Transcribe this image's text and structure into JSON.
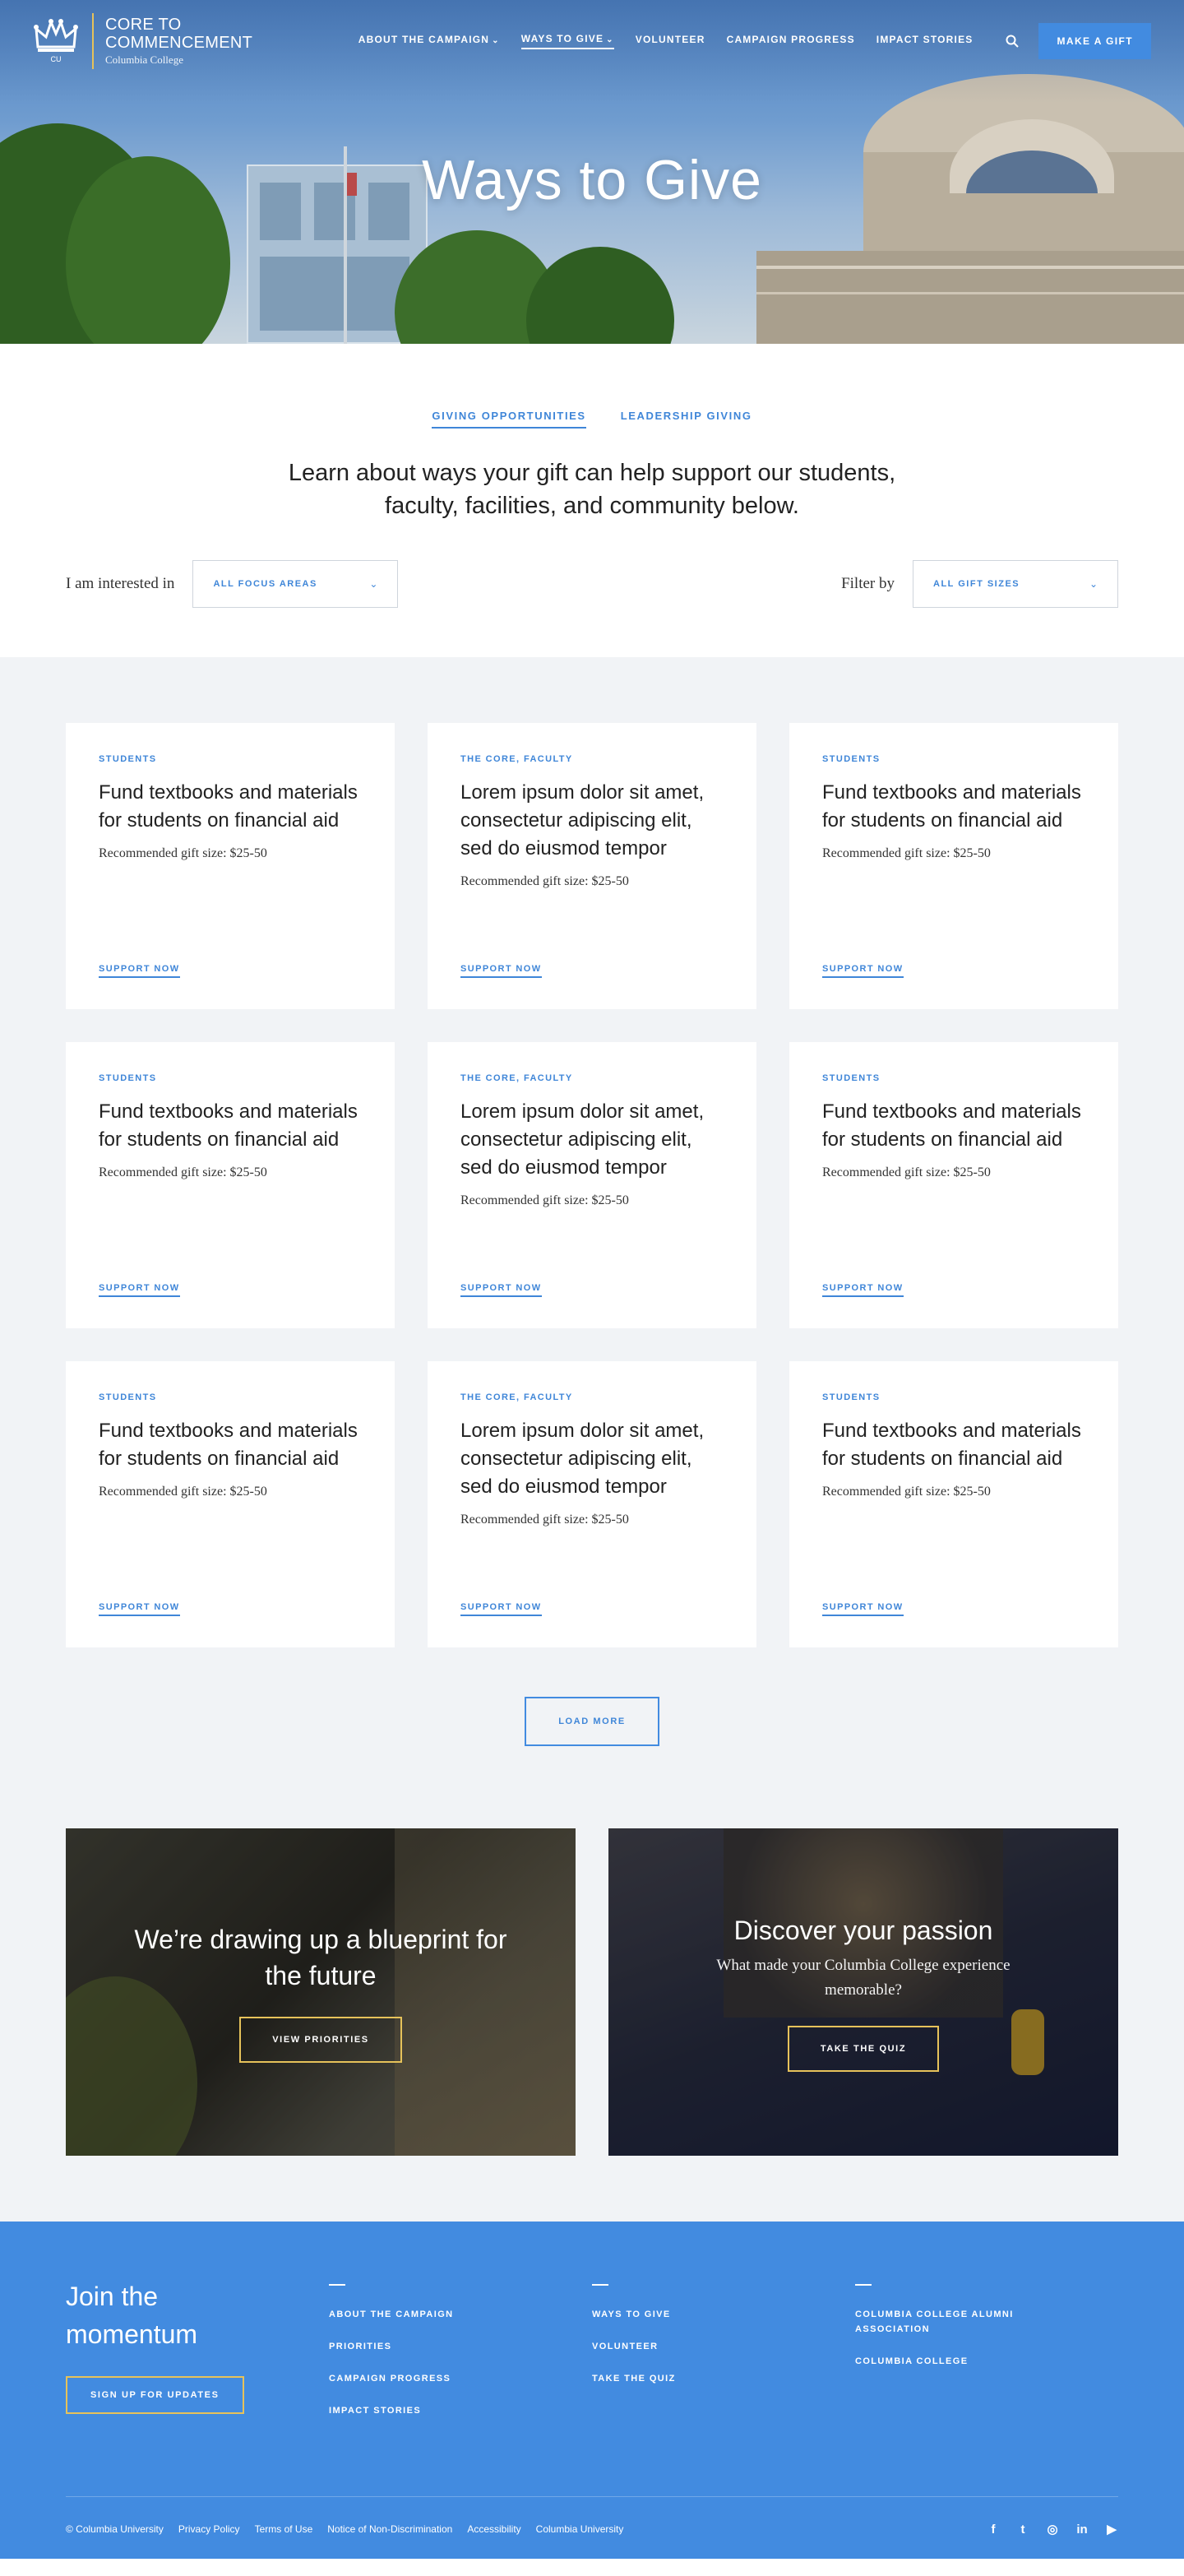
{
  "header": {
    "logo_line1": "CORE TO",
    "logo_line2": "COMMENCEMENT",
    "logo_sub": "Columbia College",
    "logo_mark": "CU",
    "nav": [
      {
        "label": "ABOUT THE CAMPAIGN",
        "has_dropdown": true
      },
      {
        "label": "WAYS TO GIVE",
        "has_dropdown": true,
        "active": true
      },
      {
        "label": "VOLUNTEER"
      },
      {
        "label": "CAMPAIGN PROGRESS"
      },
      {
        "label": "IMPACT STORIES"
      }
    ],
    "search_icon": "search-icon",
    "cta": "MAKE A GIFT",
    "hero_title": "Ways to Give"
  },
  "intro": {
    "tabs": [
      "GIVING OPPORTUNITIES",
      "LEADERSHIP GIVING"
    ],
    "lead": "Learn about ways your gift can help support our students, faculty, facilities, and community below.",
    "filter_left_label": "I am interested in",
    "filter_left_value": "ALL FOCUS AREAS",
    "filter_right_label": "Filter by",
    "filter_right_value": "ALL GIFT SIZES"
  },
  "cards": [
    {
      "category": "STUDENTS",
      "title": "Fund textbooks and materials for students on financial aid",
      "gift": "Recommended gift size: $25-50",
      "link": "SUPPORT NOW"
    },
    {
      "category": "THE CORE, FACULTY",
      "title": "Lorem ipsum dolor sit amet, consectetur adipiscing elit, sed do eiusmod tempor",
      "gift": "Recommended gift size: $25-50",
      "link": "SUPPORT NOW"
    },
    {
      "category": "STUDENTS",
      "title": "Fund textbooks and materials for students on financial aid",
      "gift": "Recommended gift size: $25-50",
      "link": "SUPPORT NOW"
    },
    {
      "category": "STUDENTS",
      "title": "Fund textbooks and materials for students on financial aid",
      "gift": "Recommended gift size: $25-50",
      "link": "SUPPORT NOW"
    },
    {
      "category": "THE CORE, FACULTY",
      "title": "Lorem ipsum dolor sit amet, consectetur adipiscing elit, sed do eiusmod tempor",
      "gift": "Recommended gift size: $25-50",
      "link": "SUPPORT NOW"
    },
    {
      "category": "STUDENTS",
      "title": "Fund textbooks and materials for students on financial aid",
      "gift": "Recommended gift size: $25-50",
      "link": "SUPPORT NOW"
    },
    {
      "category": "STUDENTS",
      "title": "Fund textbooks and materials for students on financial aid",
      "gift": "Recommended gift size: $25-50",
      "link": "SUPPORT NOW"
    },
    {
      "category": "THE CORE, FACULTY",
      "title": "Lorem ipsum dolor sit amet, consectetur adipiscing elit, sed do eiusmod tempor",
      "gift": "Recommended gift size: $25-50",
      "link": "SUPPORT NOW"
    },
    {
      "category": "STUDENTS",
      "title": "Fund textbooks and materials for students on financial aid",
      "gift": "Recommended gift size: $25-50",
      "link": "SUPPORT NOW"
    }
  ],
  "load_more": "LOAD MORE",
  "promos": [
    {
      "title": "We’re drawing up a blueprint for the future",
      "subtitle": "",
      "button": "VIEW PRIORITIES"
    },
    {
      "title": "Discover your passion",
      "subtitle": "What made your Columbia College experience memorable?",
      "button": "TAKE THE QUIZ"
    }
  ],
  "footer": {
    "join_title": "Join the momentum",
    "signup": "SIGN UP FOR UPDATES",
    "col1": [
      "ABOUT THE CAMPAIGN",
      "PRIORITIES",
      "CAMPAIGN PROGRESS",
      "IMPACT STORIES"
    ],
    "col2": [
      "WAYS TO GIVE",
      "VOLUNTEER",
      "TAKE THE QUIZ"
    ],
    "col3": [
      "COLUMBIA COLLEGE ALUMNI ASSOCIATION",
      "COLUMBIA COLLEGE"
    ],
    "legal": [
      "© Columbia University",
      "Privacy Policy",
      "Terms of Use",
      "Notice of Non-Discrimination",
      "Accessibility",
      "Columbia University"
    ],
    "social": [
      {
        "icon": "facebook-icon",
        "glyph": "f"
      },
      {
        "icon": "twitter-icon",
        "glyph": "t"
      },
      {
        "icon": "instagram-icon",
        "glyph": "◎"
      },
      {
        "icon": "linkedin-icon",
        "glyph": "in"
      },
      {
        "icon": "youtube-icon",
        "glyph": "▶"
      }
    ]
  },
  "colors": {
    "accent": "#428be0",
    "gold": "#e6c25a",
    "bg_light": "#f1f3f6"
  }
}
